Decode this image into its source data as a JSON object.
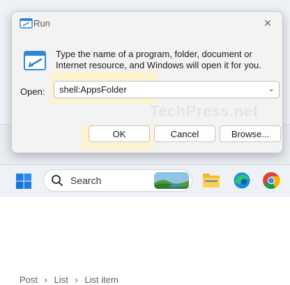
{
  "dialog": {
    "title": "Run",
    "description": "Type the name of a program, folder, document or Internet resource, and Windows will open it for you.",
    "open_label": "Open:",
    "open_value": "shell:AppsFolder",
    "buttons": {
      "ok": "OK",
      "cancel": "Cancel",
      "browse": "Browse..."
    },
    "close_glyph": "✕",
    "dropdown_glyph": "⌄"
  },
  "background": {
    "breadcrumb": [
      "Post",
      "›",
      "List",
      "›",
      "List item"
    ],
    "watermark": "TechPress.net"
  },
  "taskbar": {
    "search_placeholder": "Search"
  },
  "colors": {
    "highlight": "#fdf3cf",
    "dialog_bg": "#f3f3f3",
    "taskbar_bg": "#eef1f6",
    "accent": "#0078d4"
  },
  "icons": [
    "run-icon",
    "close-icon",
    "chevron-down-icon",
    "windows-start-icon",
    "search-icon",
    "file-explorer-icon",
    "edge-icon",
    "chrome-icon"
  ]
}
